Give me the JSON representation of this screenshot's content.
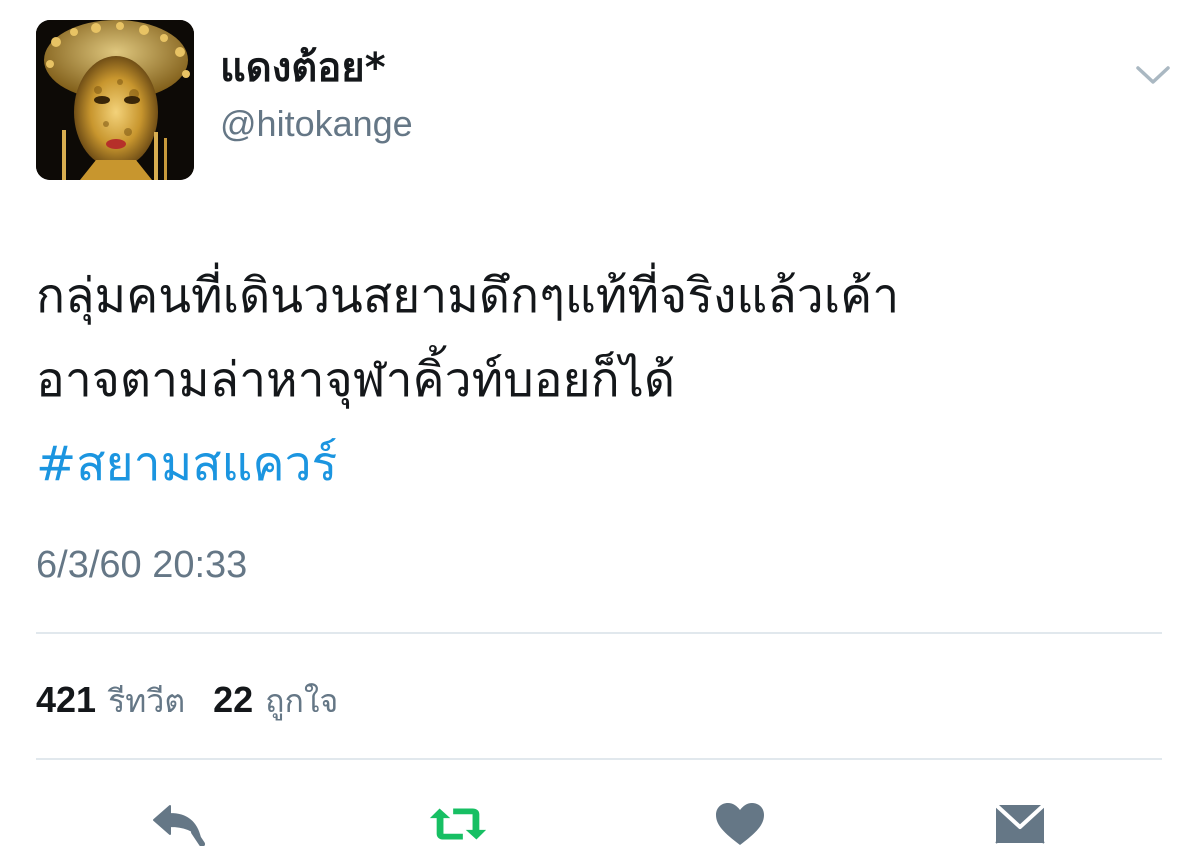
{
  "author": {
    "display_name": "แดงต้อย*",
    "handle": "@hitokange"
  },
  "tweet": {
    "text_lines": [
      "กลุ่มคนที่เดินวนสยามดึกๆแท้ที่จริงแล้วเค้า",
      "อาจตามล่าหาจุฬาคิ้วท์บอยก็ได้"
    ],
    "hashtag": "#สยามสแควร์",
    "timestamp": "6/3/60 20:33"
  },
  "stats": {
    "retweet_count": "421",
    "retweet_label": "รีทวีต",
    "like_count": "22",
    "like_label": "ถูกใจ"
  },
  "icons": {
    "caret": "chevron-down-icon",
    "reply": "reply-icon",
    "retweet": "retweet-icon",
    "like": "heart-icon",
    "dm": "envelope-icon"
  },
  "colors": {
    "text": "#14171a",
    "secondary": "#657786",
    "link": "#1b95e0",
    "retweet_active": "#17bf63",
    "icon_gray": "#657786",
    "divider": "#e1e8ed"
  }
}
